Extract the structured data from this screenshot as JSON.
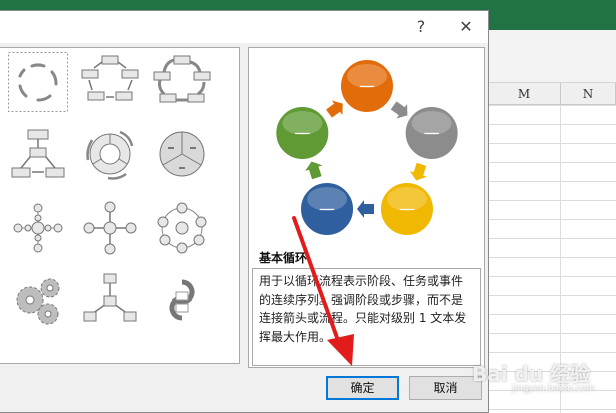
{
  "excel": {
    "columns": [
      "M",
      "N"
    ]
  },
  "dialog": {
    "help_glyph": "?",
    "close_glyph": "✕",
    "selected_layout": {
      "name": "基本循环",
      "description": "用于以循环流程表示阶段、任务或事件的连续序列。强调阶段或步骤，而不是连接箭头或流程。只能对级别 1 文本发挥最大作用。"
    },
    "preview_node_label": "—",
    "ok_label": "确定",
    "cancel_label": "取消"
  },
  "gallery": {
    "items": [
      {
        "name": "basic-cycle"
      },
      {
        "name": "text-cycle"
      },
      {
        "name": "segmented-cycle-flow"
      },
      {
        "name": "hierarchy-flow"
      },
      {
        "name": "cycle-arrows"
      },
      {
        "name": "segmented-pie"
      },
      {
        "name": "radial-list"
      },
      {
        "name": "diverging-radial"
      },
      {
        "name": "radial-cycle"
      },
      {
        "name": "gear"
      },
      {
        "name": "radial-tree"
      },
      {
        "name": "arrow-loop"
      }
    ]
  },
  "preview_colors": [
    "#e36c0a",
    "#8c8c8c",
    "#f0b800",
    "#2f5f9e",
    "#5f9a35"
  ],
  "watermark": {
    "brand": "Bai du 经验",
    "sub": "jingyan.baidu.com"
  }
}
